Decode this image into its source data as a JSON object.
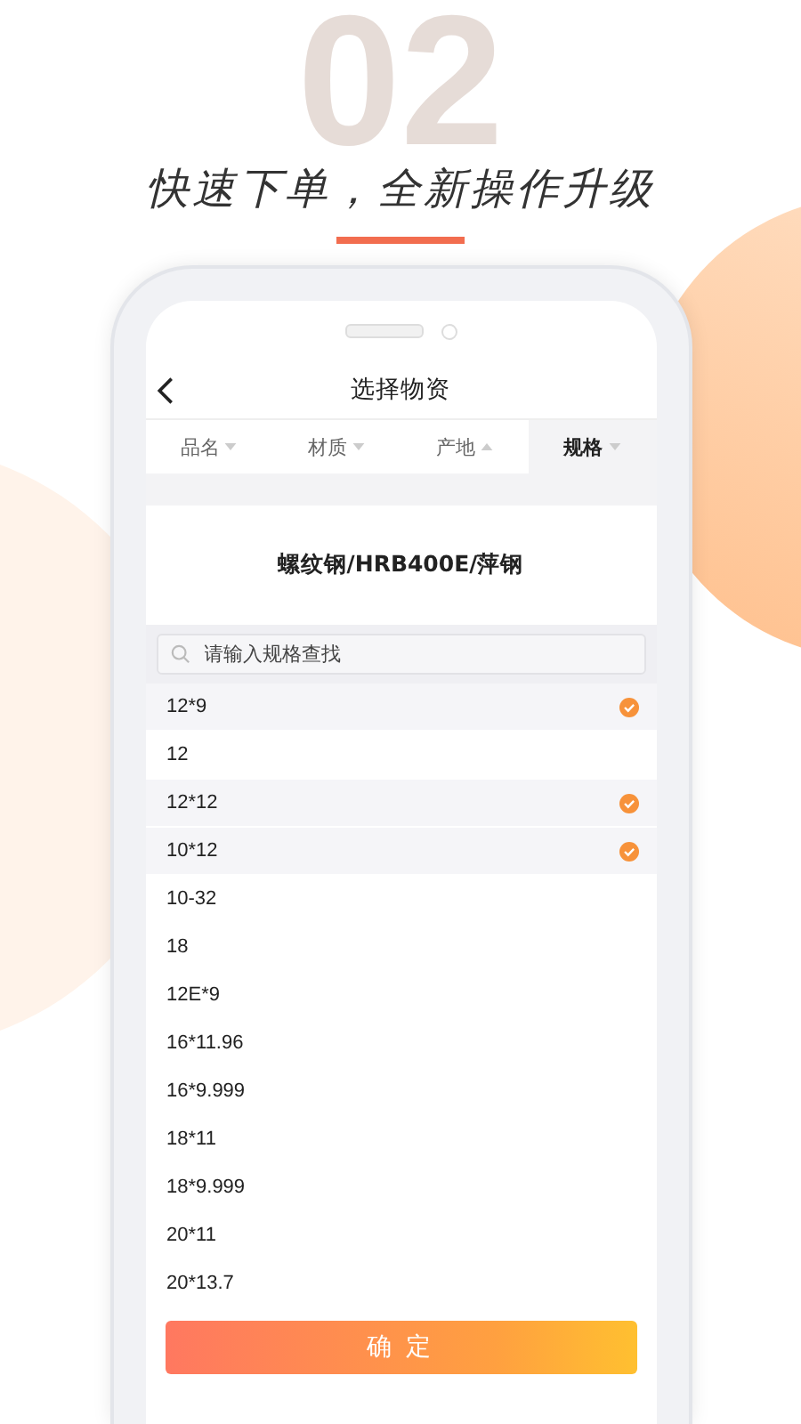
{
  "banner": {
    "big_number": "02",
    "title": "快速下单，全新操作升级"
  },
  "screen": {
    "nav": {
      "title": "选择物资"
    },
    "tabs": [
      {
        "label": "品名",
        "selected": false,
        "expanded": false
      },
      {
        "label": "材质",
        "selected": false,
        "expanded": false
      },
      {
        "label": "产地",
        "selected": false,
        "expanded": true
      },
      {
        "label": "规格",
        "selected": true,
        "expanded": false
      }
    ],
    "product": "螺纹钢/HRB400E/萍钢",
    "search": {
      "placeholder": "请输入规格查找"
    },
    "specs": [
      {
        "label": "12*9",
        "selected": true
      },
      {
        "label": "12",
        "selected": false
      },
      {
        "label": "12*12",
        "selected": true
      },
      {
        "label": "10*12",
        "selected": true
      },
      {
        "label": "10-32",
        "selected": false
      },
      {
        "label": "18",
        "selected": false
      },
      {
        "label": "12E*9",
        "selected": false
      },
      {
        "label": "16*11.96",
        "selected": false
      },
      {
        "label": "16*9.999",
        "selected": false
      },
      {
        "label": "18*11",
        "selected": false
      },
      {
        "label": "18*9.999",
        "selected": false
      },
      {
        "label": "20*11",
        "selected": false
      },
      {
        "label": "20*13.7",
        "selected": false
      }
    ],
    "confirm_button": "确 定"
  }
}
